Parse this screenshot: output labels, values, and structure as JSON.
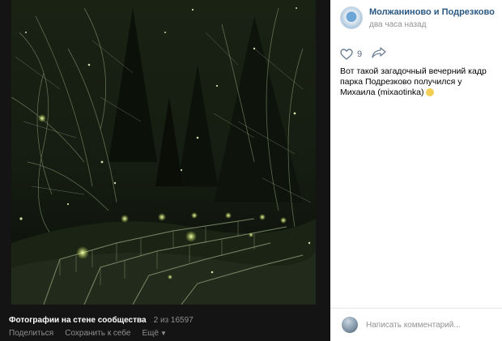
{
  "viewer": {
    "album_title": "Фотографии на стене сообщества",
    "counter": "2 из 16597",
    "share_label": "Поделиться",
    "save_label": "Сохранить к себе",
    "more_label": "Ещё"
  },
  "post": {
    "author": "Молжаниново и Подрезково",
    "time": "два часа назад",
    "likes": "9",
    "text": "Вот такой загадочный вечерний кадр парка Подрезково получился у Михаила (mixaotinka)"
  },
  "comment": {
    "placeholder": "Написать комментарий..."
  },
  "colors": {
    "link": "#2a5885",
    "muted": "#939393",
    "viewer_bg": "#141414"
  },
  "icons": [
    "heart-icon",
    "share-arrow-icon",
    "chevron-down-icon",
    "clap-emoji-icon"
  ]
}
